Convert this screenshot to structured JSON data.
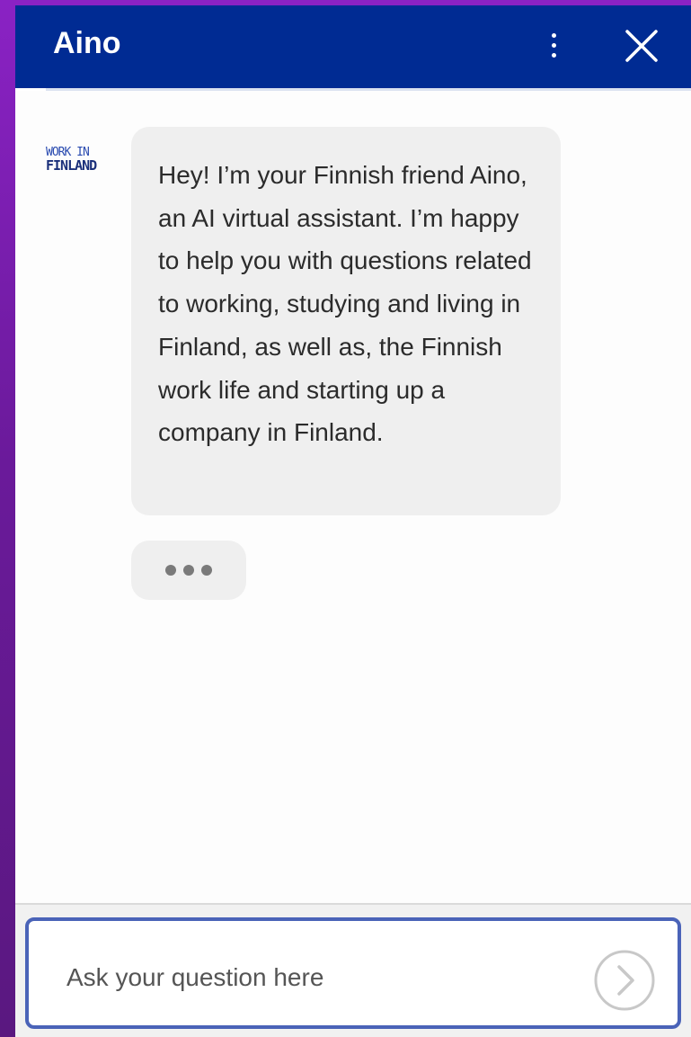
{
  "header": {
    "title": "Aino",
    "menu_icon": "more-vertical-icon",
    "close_icon": "close-icon"
  },
  "avatar": {
    "line1": "WORK IN",
    "line2": "FINLAND"
  },
  "messages": [
    {
      "sender": "bot",
      "text": "Hey! I’m your Finnish friend Aino, an AI virtual assistant. I’m happy to help you with questions related to working, studying and living in Finland, as well as, the Finnish work life and starting up a company in Finland."
    }
  ],
  "typing_indicator_icon": "typing-dots-icon",
  "composer": {
    "placeholder": "Ask your question here",
    "value": "",
    "send_icon": "send-arrow-icon"
  },
  "colors": {
    "header_bg": "#002b93",
    "bubble_bg": "#efefef",
    "input_border": "#4a63b8",
    "page_bg": "#8a22c4"
  }
}
